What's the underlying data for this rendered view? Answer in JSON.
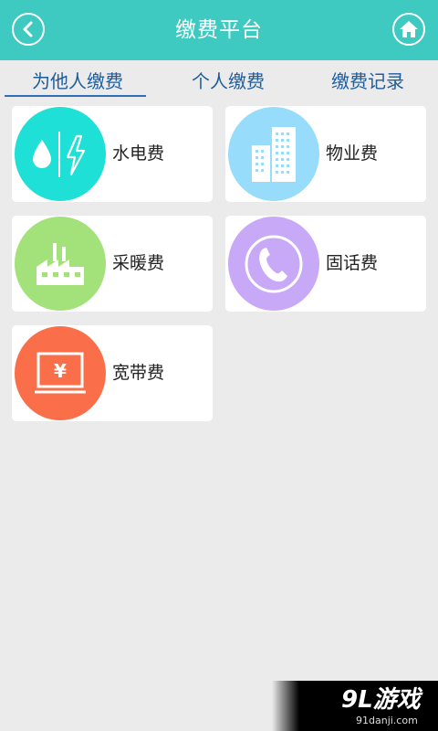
{
  "header": {
    "title": "缴费平台",
    "back_icon": "back-icon",
    "home_icon": "home-icon",
    "background": "#3ec9c1"
  },
  "tabs": [
    {
      "label": "为他人缴费",
      "active": true
    },
    {
      "label": "个人缴费",
      "active": false
    },
    {
      "label": "缴费记录",
      "active": false
    }
  ],
  "services": [
    {
      "label": "水电费",
      "icon": "water-electricity-icon",
      "color": "#1fe0d6"
    },
    {
      "label": "物业费",
      "icon": "building-icon",
      "color": "#97dcfb"
    },
    {
      "label": "采暖费",
      "icon": "factory-icon",
      "color": "#a3e27a"
    },
    {
      "label": "固话费",
      "icon": "telephone-icon",
      "color": "#c8a9f7"
    },
    {
      "label": "宽带费",
      "icon": "monitor-yuan-icon",
      "color": "#fb6e4a"
    }
  ],
  "watermark": {
    "logo": "9L游戏",
    "site": "91danji.com"
  }
}
